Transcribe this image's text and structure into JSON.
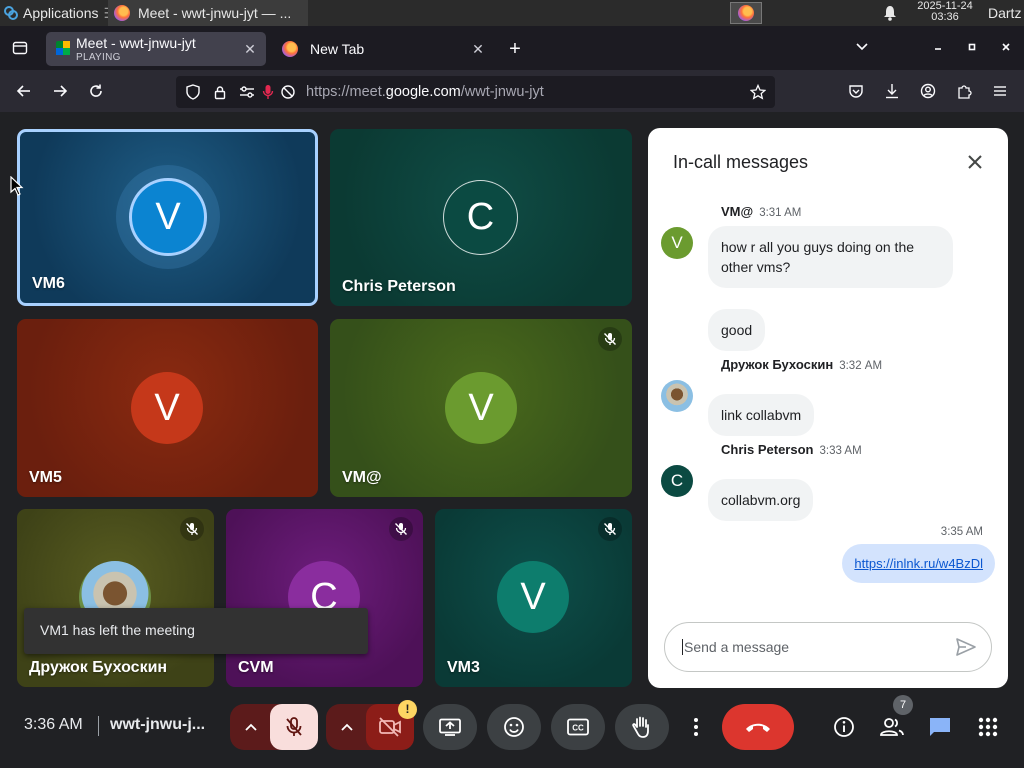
{
  "taskbar": {
    "applications_label": "Applications",
    "task_title": "Meet - wwt-jnwu-jyt — ...",
    "clock_date": "2025-11-24",
    "clock_time": "03:36",
    "user": "Dartz"
  },
  "browser": {
    "tabs": [
      {
        "title": "Meet - wwt-jnwu-jyt",
        "subtitle": "PLAYING"
      },
      {
        "title": "New Tab"
      }
    ],
    "new_tab_symbol": "+",
    "url_prefix": "https://meet.",
    "url_host": "google.com",
    "url_path": "/wwt-jnwu-jyt"
  },
  "meet": {
    "tiles": [
      {
        "name": "VM6",
        "initial": "V",
        "color": "#0b84d1"
      },
      {
        "name": "Chris Peterson",
        "initial": "C",
        "color": "#0b4a42"
      },
      {
        "name": "VM5",
        "initial": "V",
        "color": "#c5381a"
      },
      {
        "name": "VM@",
        "initial": "V",
        "color": "#6b9b2f"
      },
      {
        "name": "Дружок Бухоскин",
        "initial": "",
        "color": "#6b9b2f"
      },
      {
        "name": "CVM",
        "initial": "C",
        "color": "#8a2d9e"
      },
      {
        "name": "VM3",
        "initial": "V",
        "color": "#0d7d6d"
      }
    ],
    "toast": "VM1 has left the meeting",
    "chat": {
      "title": "In-call messages",
      "messages": [
        {
          "sender": "VM@",
          "time": "3:31 AM",
          "texts": [
            "how r all you guys doing on the other vms?",
            "good"
          ],
          "initial": "V"
        },
        {
          "sender": "Дружок Бухоскин",
          "time": "3:32 AM",
          "texts": [
            "link collabvm"
          ]
        },
        {
          "sender": "Chris Peterson",
          "time": "3:33 AM",
          "texts": [
            "collabvm.org"
          ],
          "initial": "C"
        }
      ],
      "own_message": {
        "time": "3:35 AM",
        "text": "https://inlnk.ru/w4BzDl"
      },
      "input_placeholder": "Send a message"
    },
    "bottom": {
      "time": "3:36 AM",
      "meeting_code": "wwt-jnwu-j...",
      "camera_warning": "!",
      "people_count": "7"
    }
  }
}
